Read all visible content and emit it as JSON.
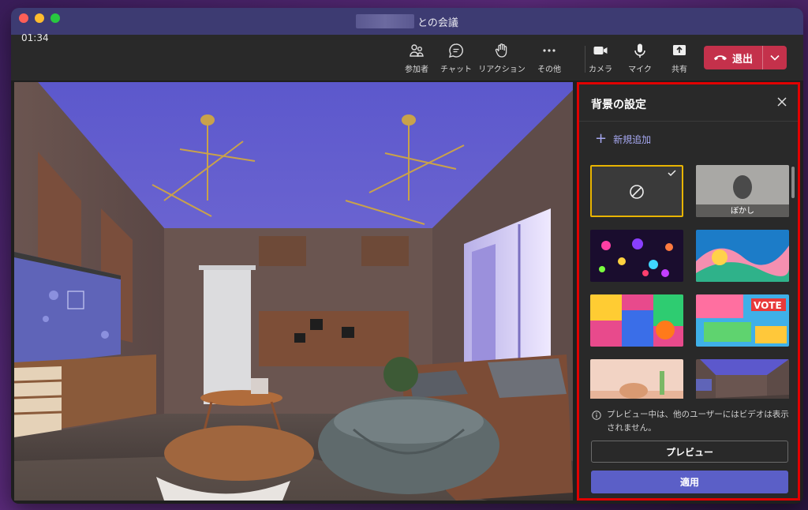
{
  "window": {
    "title": "との会議",
    "timer": "01:34"
  },
  "toolbar": {
    "participants": "参加者",
    "chat": "チャット",
    "reactions": "リアクション",
    "more": "その他",
    "camera": "カメラ",
    "mic": "マイク",
    "share": "共有",
    "leave": "退出"
  },
  "panel": {
    "title": "背景の設定",
    "add_new": "新規追加",
    "blur_label": "ぼかし",
    "info_text": "プレビュー中は、他のユーザーにはビデオは表示されません。",
    "preview_button": "プレビュー",
    "apply_button": "適用",
    "backgrounds": [
      {
        "name": "none",
        "selected": true
      },
      {
        "name": "blur"
      },
      {
        "name": "bokeh-lights"
      },
      {
        "name": "colorful-wave"
      },
      {
        "name": "abstract-collage"
      },
      {
        "name": "vote-art"
      },
      {
        "name": "desert-scene"
      },
      {
        "name": "room-interior"
      }
    ]
  },
  "colors": {
    "titlebar": "#3d3b72",
    "leave_button": "#c4314b",
    "apply_button": "#5b5fc7",
    "accent_link": "#a5a7f0",
    "highlight_border": "#e10000",
    "selection_border": "#e8b400"
  }
}
